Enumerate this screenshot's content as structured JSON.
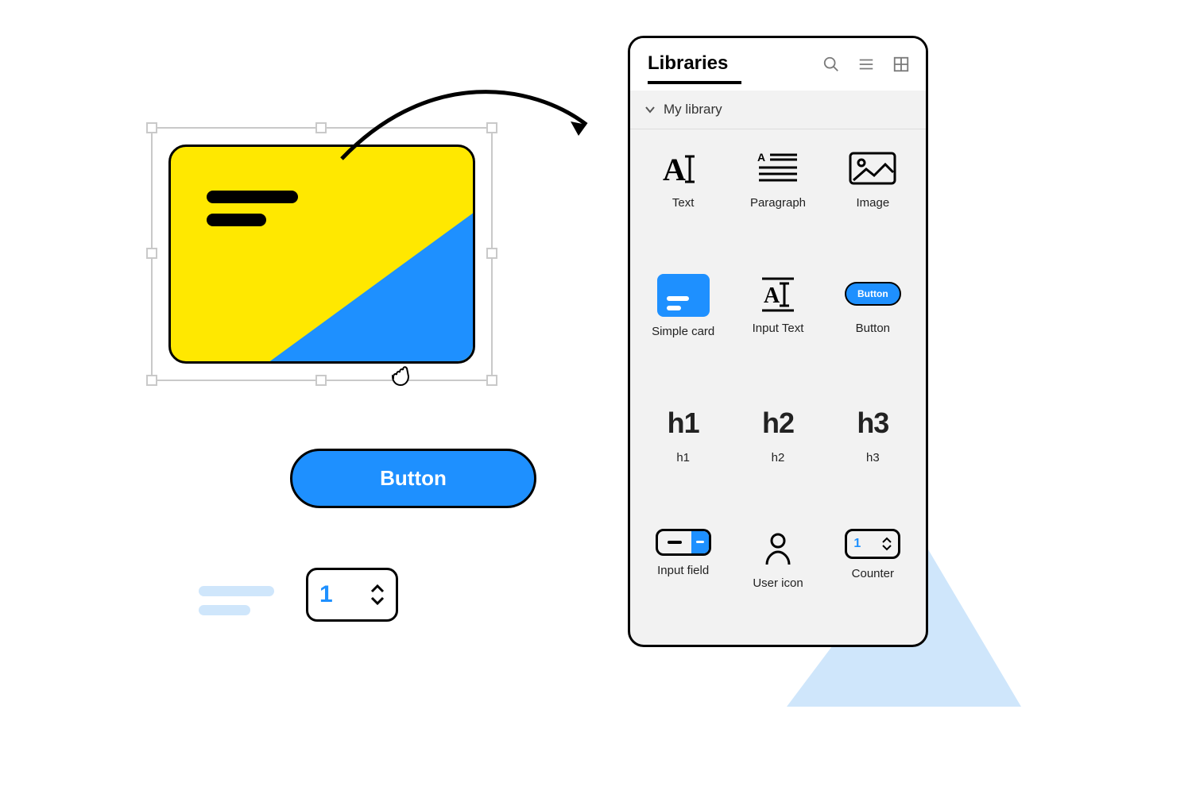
{
  "canvas": {
    "main_button_label": "Button",
    "counter_value": "1"
  },
  "panel": {
    "title": "Libraries",
    "section_label": "My library",
    "items": [
      {
        "label": "Text"
      },
      {
        "label": "Paragraph"
      },
      {
        "label": "Image"
      },
      {
        "label": "Simple card"
      },
      {
        "label": "Input Text"
      },
      {
        "label": "Button",
        "chip_label": "Button"
      },
      {
        "label": "h1",
        "glyph": "h1"
      },
      {
        "label": "h2",
        "glyph": "h2"
      },
      {
        "label": "h3",
        "glyph": "h3"
      },
      {
        "label": "Input field"
      },
      {
        "label": "User icon"
      },
      {
        "label": "Counter",
        "value": "1"
      }
    ]
  }
}
